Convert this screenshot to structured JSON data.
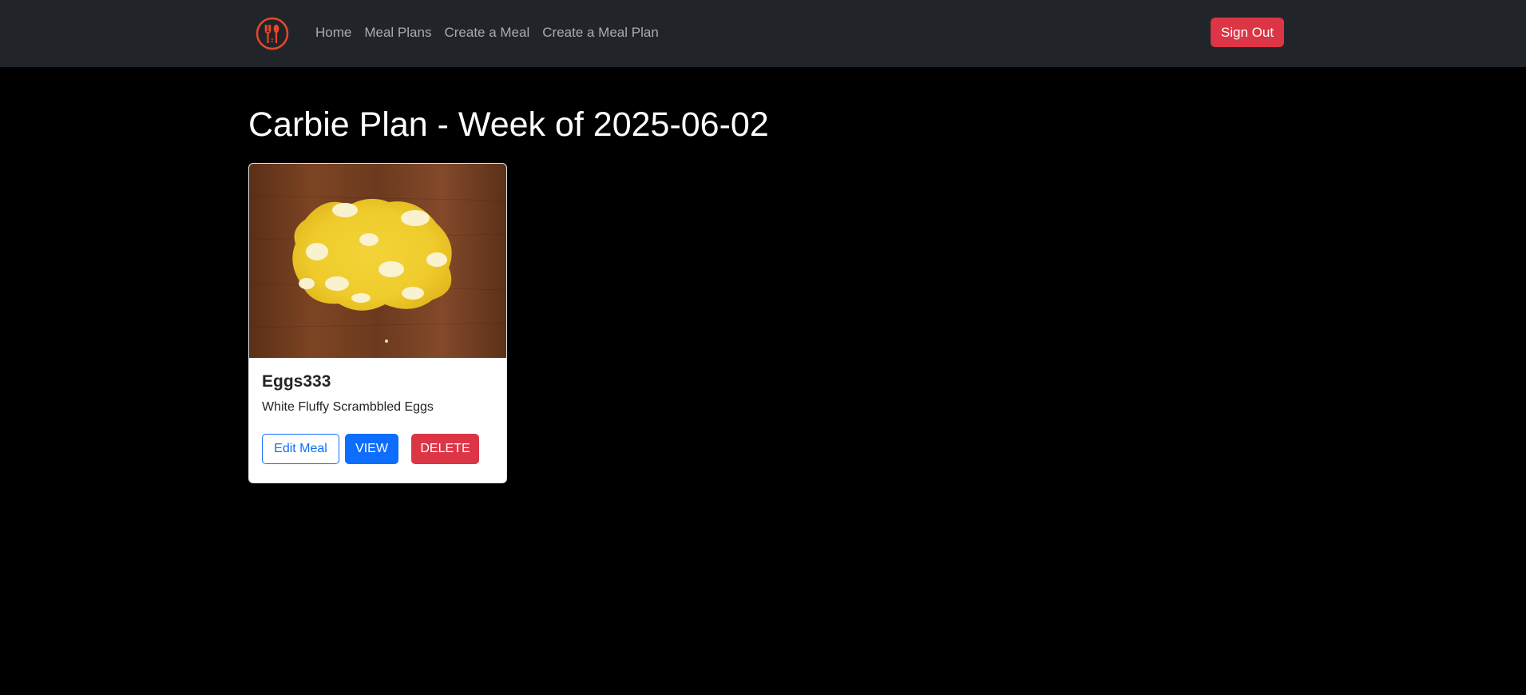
{
  "navbar": {
    "logo_icon": "fork-spoon-logo-icon",
    "links": [
      "Home",
      "Meal Plans",
      "Create a Meal",
      "Create a Meal Plan"
    ],
    "signout_label": "Sign Out"
  },
  "page": {
    "title": "Carbie Plan - Week of 2025-06-02"
  },
  "meal_card": {
    "image_alt": "scrambled-eggs-photo",
    "title": "Eggs333",
    "description": "White Fluffy Scrambbled Eggs",
    "edit_label": "Edit Meal",
    "view_label": "VIEW",
    "delete_label": "DELETE"
  },
  "colors": {
    "navbar_bg": "#212529",
    "page_bg": "#000000",
    "primary": "#0d6efd",
    "danger": "#dc3545",
    "logo_accent": "#e8472b"
  }
}
